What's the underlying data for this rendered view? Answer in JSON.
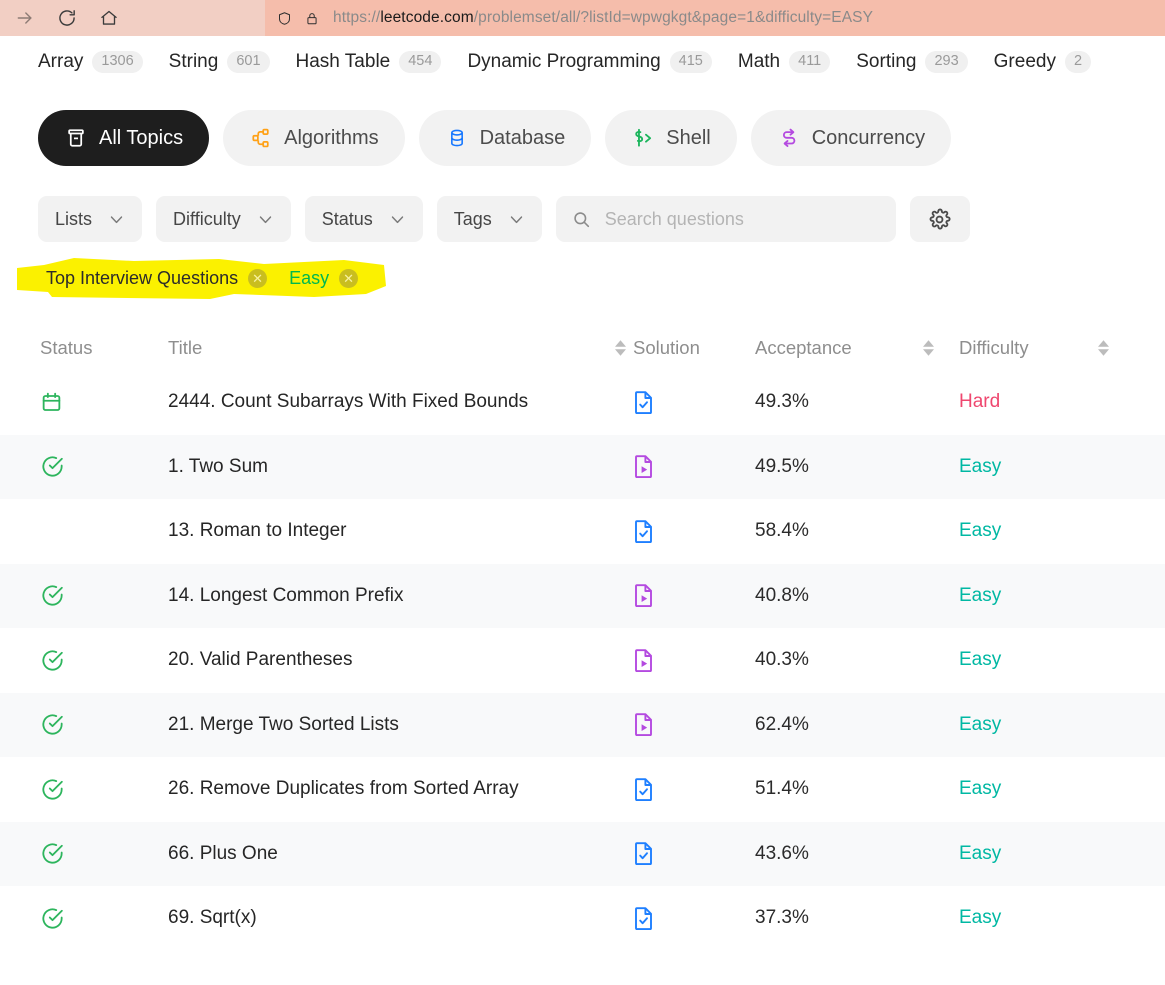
{
  "browser": {
    "nav": [
      {
        "name": "forward-button",
        "glyph": "→",
        "state": "disabled"
      },
      {
        "name": "reload-button",
        "glyph": "reload",
        "state": "enabled"
      },
      {
        "name": "home-button",
        "glyph": "home",
        "state": "enabled"
      }
    ],
    "url_prefix": "https://",
    "url_host": "leetcode.com",
    "url_path": "/problemset/all/?listId=wpwgkgt&page=1&difficulty=EASY",
    "shield_icon": "shield-icon",
    "lock_icon": "lock-icon"
  },
  "topics": [
    {
      "label": "Array",
      "count": "1306"
    },
    {
      "label": "String",
      "count": "601"
    },
    {
      "label": "Hash Table",
      "count": "454"
    },
    {
      "label": "Dynamic Programming",
      "count": "415"
    },
    {
      "label": "Math",
      "count": "411"
    },
    {
      "label": "Sorting",
      "count": "293"
    },
    {
      "label": "Greedy",
      "count": "2"
    }
  ],
  "categories": [
    {
      "label": "All Topics",
      "icon": "all-topics-icon",
      "active": true,
      "color": "#ffffff"
    },
    {
      "label": "Algorithms",
      "icon": "algorithms-icon",
      "active": false,
      "color": "#ffa116"
    },
    {
      "label": "Database",
      "icon": "database-icon",
      "active": false,
      "color": "#1677ff"
    },
    {
      "label": "Shell",
      "icon": "shell-icon",
      "active": false,
      "color": "#1bb55c"
    },
    {
      "label": "Concurrency",
      "icon": "concurrency-icon",
      "active": false,
      "color": "#b44ae0"
    }
  ],
  "filters": [
    {
      "label": "Lists",
      "name": "lists-filter"
    },
    {
      "label": "Difficulty",
      "name": "difficulty-filter"
    },
    {
      "label": "Status",
      "name": "status-filter"
    },
    {
      "label": "Tags",
      "name": "tags-filter"
    }
  ],
  "search": {
    "placeholder": "Search questions",
    "value": "",
    "icon": "search-icon"
  },
  "settings_icon": "gear-icon",
  "applied_chips": [
    {
      "label": "Top Interview Questions",
      "style": "default"
    },
    {
      "label": "Easy",
      "style": "easy"
    }
  ],
  "annotation": {
    "type": "yellow-highlighter",
    "color": "#fbf100"
  },
  "table": {
    "headers": {
      "status": "Status",
      "title": "Title",
      "solution": "Solution",
      "acceptance": "Acceptance",
      "difficulty": "Difficulty"
    },
    "rows": [
      {
        "status": "calendar",
        "title": "2444. Count Subarrays With Fixed Bounds",
        "solution": "doc-check",
        "acceptance": "49.3%",
        "difficulty": "Hard"
      },
      {
        "status": "solved",
        "title": "1. Two Sum",
        "solution": "doc-play",
        "acceptance": "49.5%",
        "difficulty": "Easy"
      },
      {
        "status": "none",
        "title": "13. Roman to Integer",
        "solution": "doc-check",
        "acceptance": "58.4%",
        "difficulty": "Easy"
      },
      {
        "status": "solved",
        "title": "14. Longest Common Prefix",
        "solution": "doc-play",
        "acceptance": "40.8%",
        "difficulty": "Easy"
      },
      {
        "status": "solved",
        "title": "20. Valid Parentheses",
        "solution": "doc-play",
        "acceptance": "40.3%",
        "difficulty": "Easy"
      },
      {
        "status": "solved",
        "title": "21. Merge Two Sorted Lists",
        "solution": "doc-play",
        "acceptance": "62.4%",
        "difficulty": "Easy"
      },
      {
        "status": "solved",
        "title": "26. Remove Duplicates from Sorted Array",
        "solution": "doc-check",
        "acceptance": "51.4%",
        "difficulty": "Easy"
      },
      {
        "status": "solved",
        "title": "66. Plus One",
        "solution": "doc-check",
        "acceptance": "43.6%",
        "difficulty": "Easy"
      },
      {
        "status": "solved",
        "title": "69. Sqrt(x)",
        "solution": "doc-check",
        "acceptance": "37.3%",
        "difficulty": "Easy"
      }
    ]
  },
  "colors": {
    "easy": "#00b8a3",
    "hard": "#ef476f",
    "solved_green": "#2db55d",
    "solution_doc": "#1e7fff",
    "solution_video": "#b44ae0",
    "highlight": "#fbf100"
  }
}
